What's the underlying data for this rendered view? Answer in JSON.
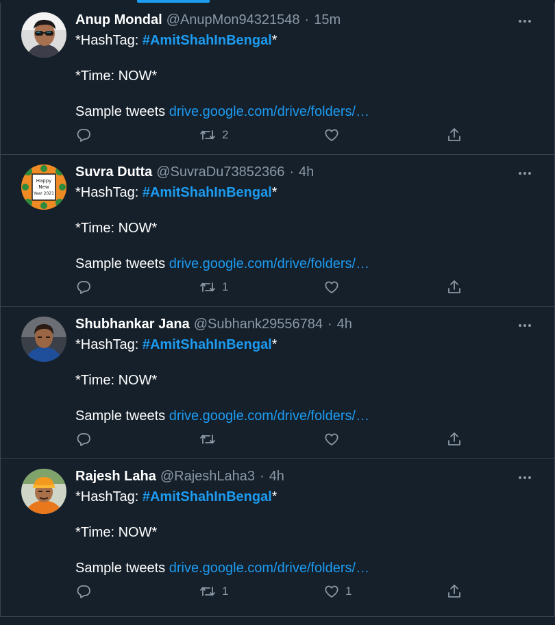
{
  "colors": {
    "background": "#15202b",
    "border": "#38444d",
    "accent": "#1d9bf0",
    "secondary_text": "#8b98a5"
  },
  "tweets": [
    {
      "name": "Anup Mondal",
      "handle": "@AnupMon94321548",
      "separator": "·",
      "time": "15m",
      "line1_prefix": "*HashTag: ",
      "hashtag": "#AmitShahInBengal",
      "line1_suffix": "*",
      "line2": "*Time: NOW*",
      "line3_prefix": "Sample tweets ",
      "link": "drive.google.com/drive/folders/…",
      "reply_count": "",
      "retweet_count": "2",
      "like_count": "",
      "avatar_icon": "man-with-sunglasses-photo"
    },
    {
      "name": "Suvra Dutta",
      "handle": "@SuvraDu73852366",
      "separator": "·",
      "time": "4h",
      "line1_prefix": "*HashTag: ",
      "hashtag": "#AmitShahInBengal",
      "line1_suffix": "*",
      "line2": "*Time: NOW*",
      "line3_prefix": "Sample tweets ",
      "link": "drive.google.com/drive/folders/…",
      "reply_count": "",
      "retweet_count": "1",
      "like_count": "",
      "avatar_icon": "new-year-lotus-graphic",
      "avatar_text": [
        "Happy",
        "New",
        "Year 2021"
      ]
    },
    {
      "name": "Shubhankar Jana",
      "handle": "@Subhank29556784",
      "separator": "·",
      "time": "4h",
      "line1_prefix": "*HashTag: ",
      "hashtag": "#AmitShahInBengal",
      "line1_suffix": "*",
      "line2": "*Time: NOW*",
      "line3_prefix": "Sample tweets ",
      "link": "drive.google.com/drive/folders/…",
      "reply_count": "",
      "retweet_count": "",
      "like_count": "",
      "avatar_icon": "man-in-blue-shirt-photo"
    },
    {
      "name": "Rajesh Laha",
      "handle": "@RajeshLaha3",
      "separator": "·",
      "time": "4h",
      "line1_prefix": "*HashTag: ",
      "hashtag": "#AmitShahInBengal",
      "line1_suffix": "*",
      "line2": "*Time: NOW*",
      "line3_prefix": "Sample tweets ",
      "link": "drive.google.com/drive/folders/…",
      "reply_count": "",
      "retweet_count": "1",
      "like_count": "1",
      "avatar_icon": "man-in-saffron-cap-photo"
    }
  ]
}
